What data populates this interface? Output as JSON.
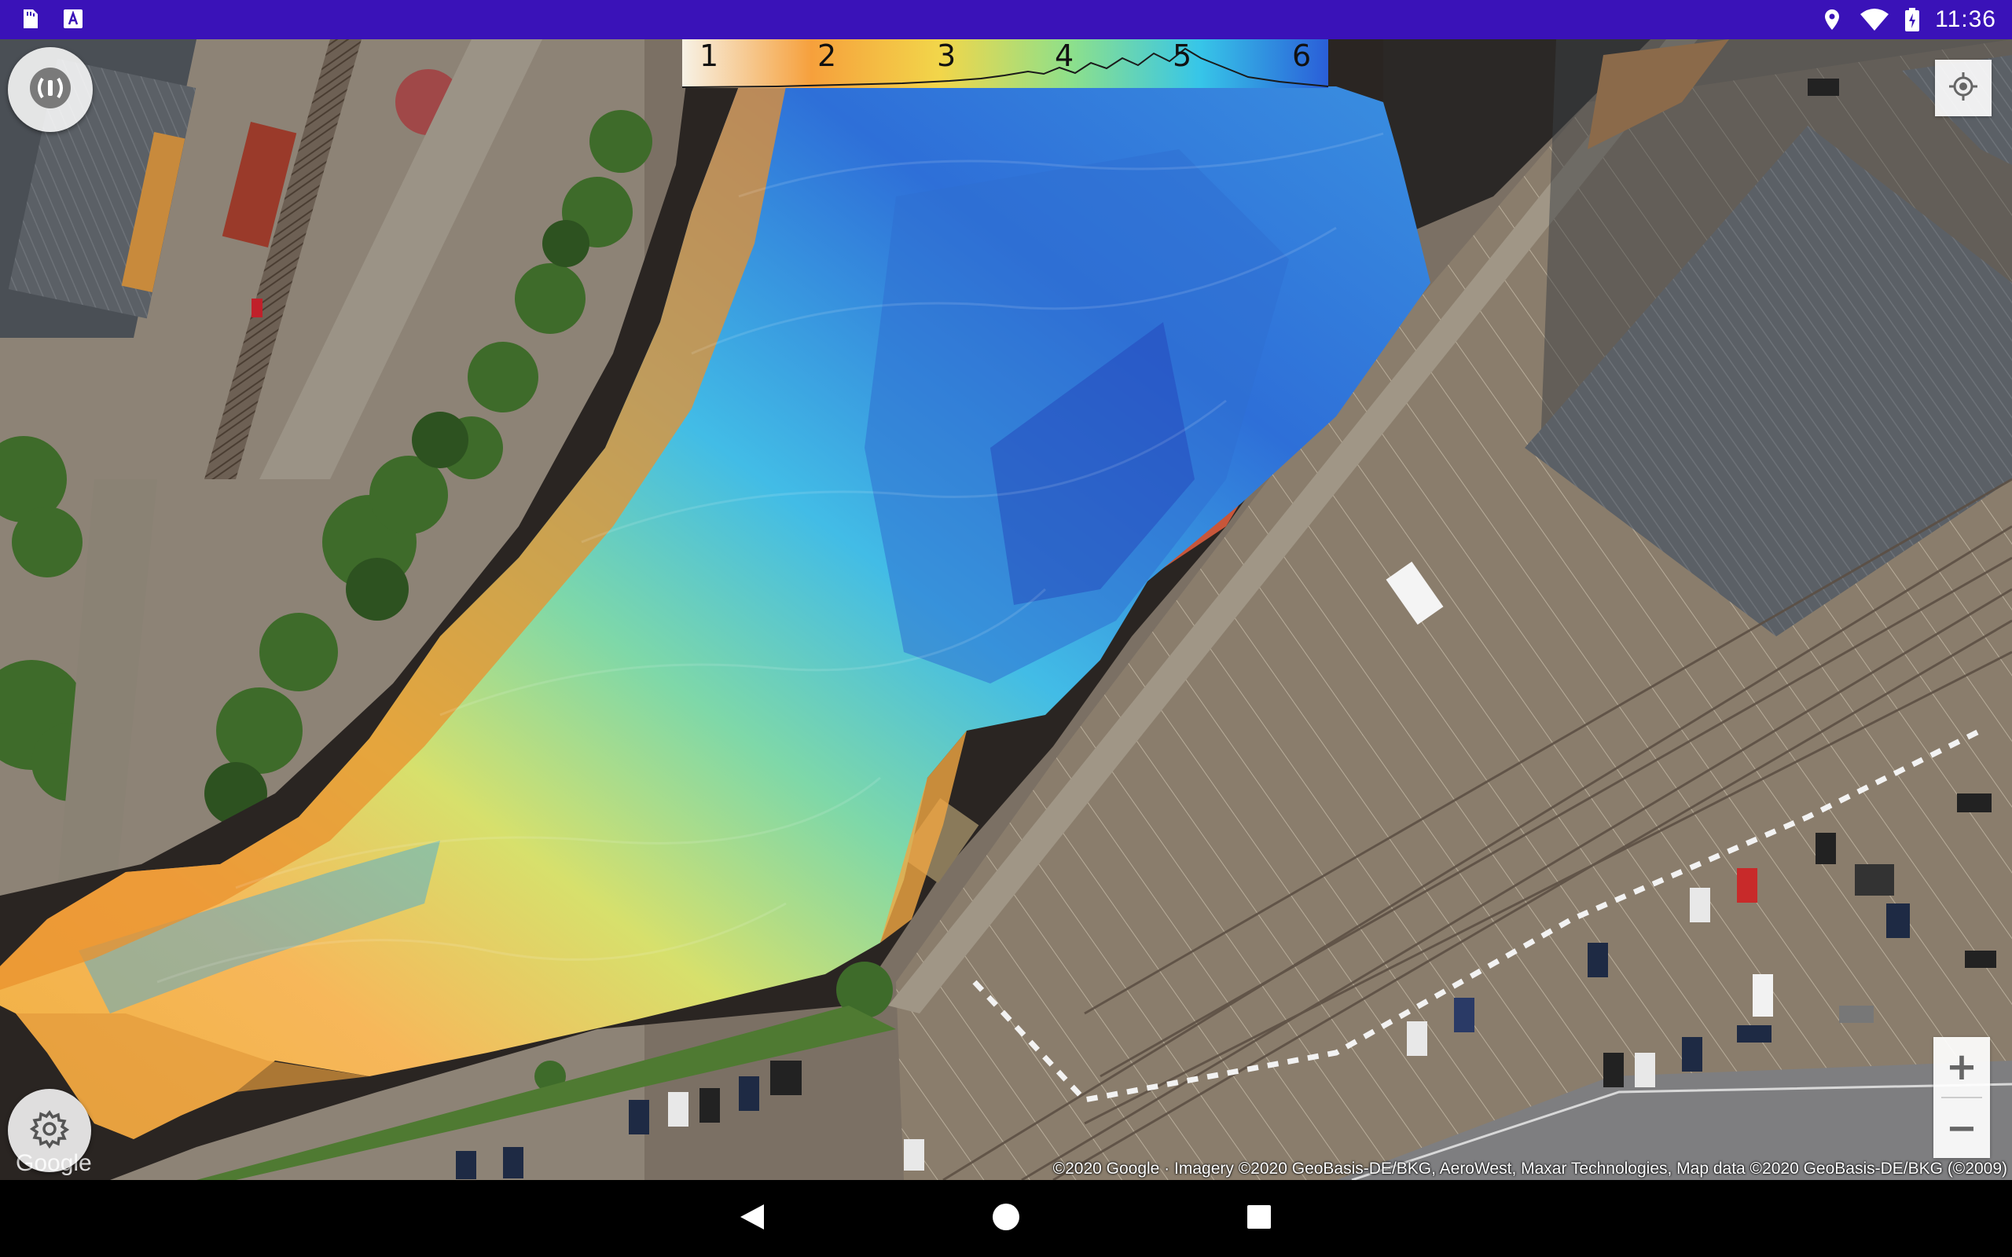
{
  "status_bar": {
    "time": "11:36",
    "left_icons": [
      "sd-card-icon",
      "a-notification-icon"
    ],
    "right_icons": [
      "location-icon",
      "wifi-icon",
      "battery-icon"
    ]
  },
  "map": {
    "legend": {
      "ticks": [
        "1",
        "2",
        "3",
        "4",
        "5",
        "6"
      ],
      "gradient_colors": [
        "#f7f2e6",
        "#f6a03c",
        "#f2d64a",
        "#8ee08a",
        "#37c6e8",
        "#2a5ed8"
      ]
    },
    "buttons": {
      "sonar": "sonar-icon",
      "settings": "settings-icon",
      "my_location": "locate-icon",
      "zoom_in": "+",
      "zoom_out": "−"
    },
    "google_logo": "Google",
    "attribution": "©2020 Google · Imagery ©2020 GeoBasis-DE/BKG, AeroWest, Maxar Technologies, Map data ©2020 GeoBasis-DE/BKG (©2009)"
  },
  "nav_bar": {
    "back": "back-icon",
    "home": "home-icon",
    "recents": "recents-icon"
  },
  "colors": {
    "status_bar": "#3a12b8",
    "nav_bar": "#000000",
    "water": "#2a2522",
    "depth_shallow": "#f6a03c",
    "depth_deep": "#2a5ed8"
  }
}
